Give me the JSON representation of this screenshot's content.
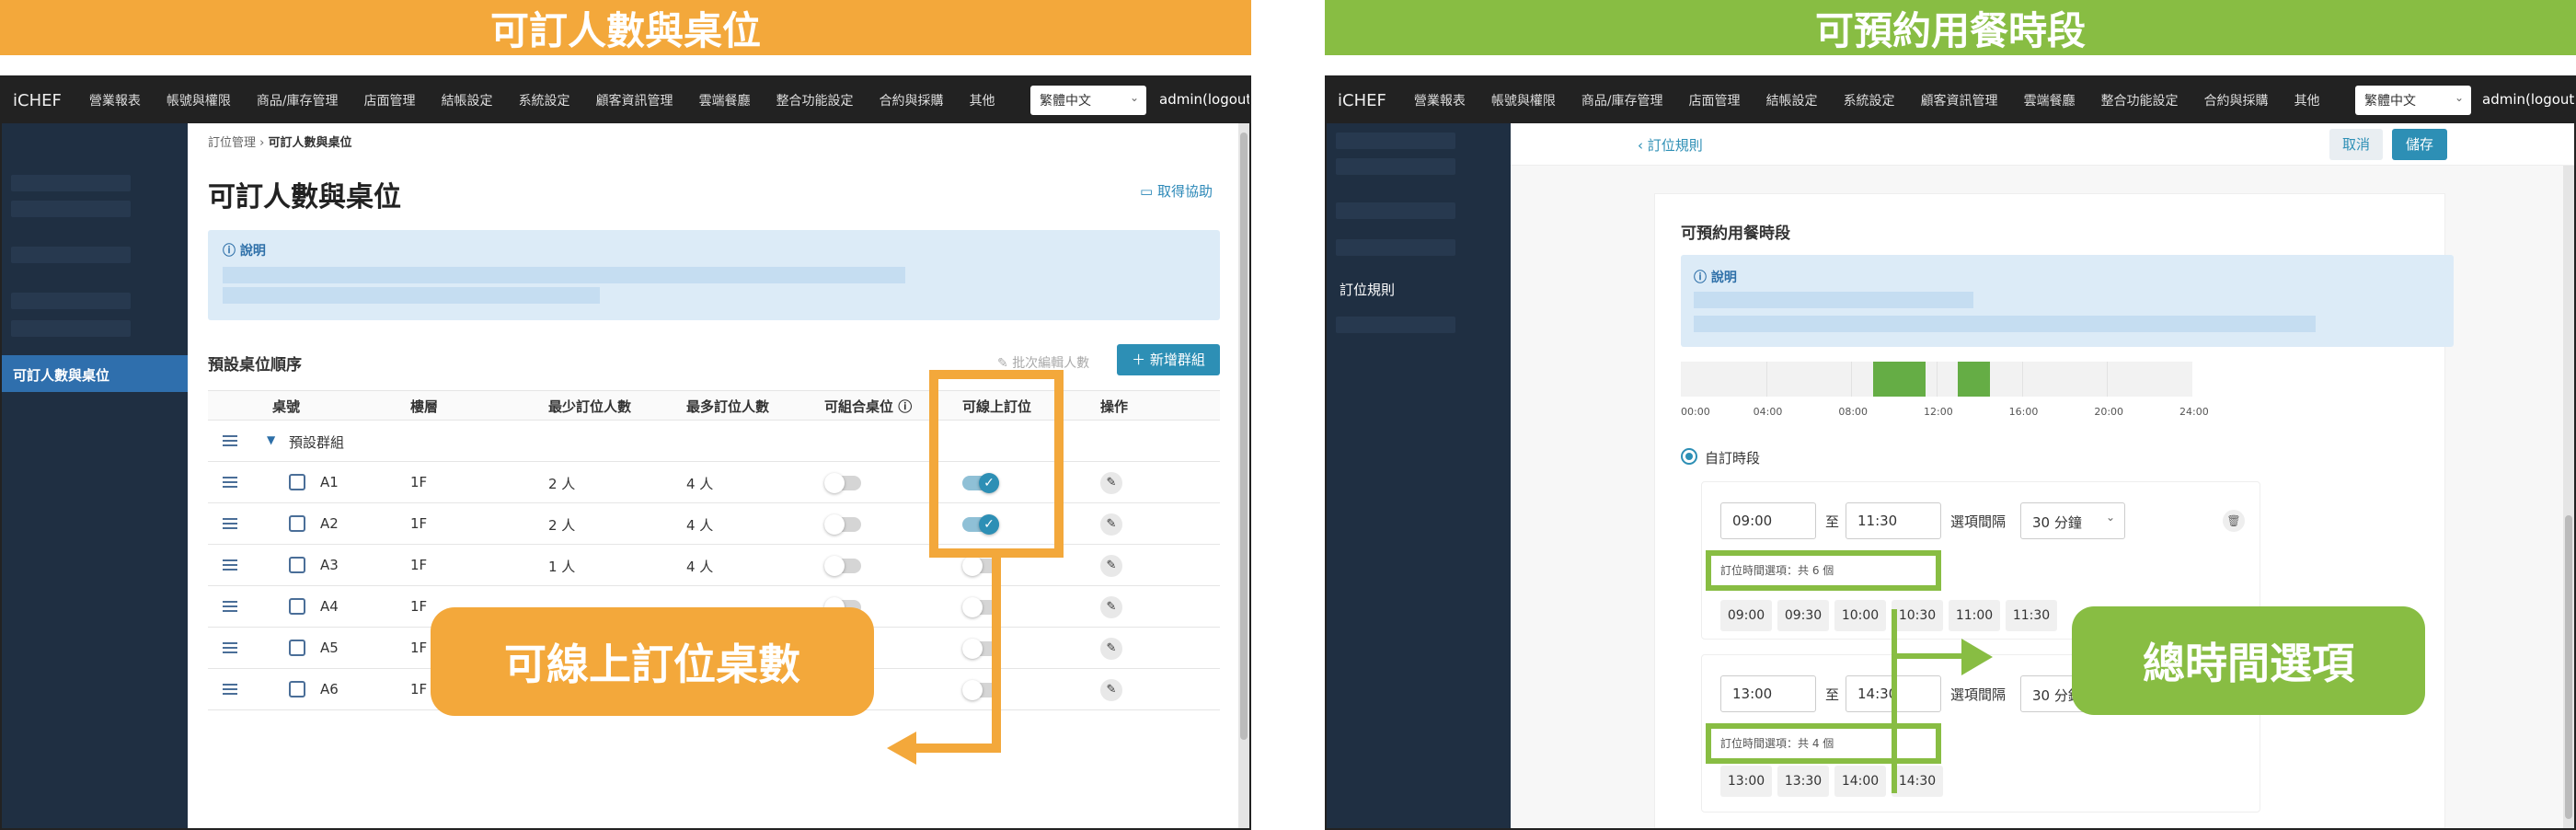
{
  "left": {
    "banner": "可訂人數與桌位",
    "nav": {
      "logo": "iCHEF",
      "items": [
        "營業報表",
        "帳號與權限",
        "商品/庫存管理",
        "店面管理",
        "結帳設定",
        "系統設定",
        "顧客資訊管理",
        "雲端餐廳",
        "整合功能設定",
        "合約與採購",
        "其他"
      ],
      "lang": "繁體中文",
      "admin": "admin(logout)"
    },
    "sidebar": {
      "active": "可訂人數與桌位"
    },
    "breadcrumb": {
      "parent": "訂位管理",
      "sep": "›",
      "current": "可訂人數與桌位"
    },
    "title": "可訂人數與桌位",
    "help": "取得協助",
    "note_header": "說明",
    "section_title": "預設桌位順序",
    "batch_edit": "批次編輯人數",
    "add_group": "＋ 新增群組",
    "table": {
      "headers": [
        "桌號",
        "樓層",
        "最少訂位人數",
        "最多訂位人數",
        "可組合桌位",
        "可線上訂位",
        "操作"
      ],
      "group": "預設群組",
      "rows": [
        {
          "name": "A1",
          "floor": "1F",
          "min": "2 人",
          "max": "4 人",
          "combine": false,
          "online": true
        },
        {
          "name": "A2",
          "floor": "1F",
          "min": "2 人",
          "max": "4 人",
          "combine": false,
          "online": true
        },
        {
          "name": "A3",
          "floor": "1F",
          "min": "1 人",
          "max": "4 人",
          "combine": false,
          "online": false
        },
        {
          "name": "A4",
          "floor": "1F",
          "min": "",
          "max": "",
          "combine": false,
          "online": false
        },
        {
          "name": "A5",
          "floor": "1F",
          "min": "",
          "max": "",
          "combine": false,
          "online": false
        },
        {
          "name": "A6",
          "floor": "1F",
          "min": "",
          "max": "",
          "combine": false,
          "online": false
        }
      ]
    },
    "callout": "可線上訂位桌數",
    "colors": {
      "accent": "#f3a83b",
      "primary": "#2d8fb5",
      "sidebar": "#1f2f42"
    }
  },
  "right": {
    "banner": "可預約用餐時段",
    "nav": {
      "logo": "iCHEF",
      "items": [
        "營業報表",
        "帳號與權限",
        "商品/庫存管理",
        "店面管理",
        "結帳設定",
        "系統設定",
        "顧客資訊管理",
        "雲端餐廳",
        "整合功能設定",
        "合約與採購",
        "其他"
      ],
      "lang": "繁體中文",
      "admin": "admin(logout)"
    },
    "sidebar": {
      "item": "訂位規則"
    },
    "back": "‹ 訂位規則",
    "cancel": "取消",
    "save": "儲存",
    "section_title": "可預約用餐時段",
    "note_header": "說明",
    "timeline": {
      "ticks": [
        "00:00",
        "04:00",
        "08:00",
        "12:00",
        "16:00",
        "20:00",
        "24:00"
      ],
      "ranges": [
        [
          9.0,
          11.5
        ],
        [
          13.0,
          14.5
        ]
      ]
    },
    "custom_label": "自訂時段",
    "slots": [
      {
        "start": "09:00",
        "to": "至",
        "end": "11:30",
        "interval_label": "選項間隔",
        "interval": "30 分鐘",
        "count_label": "訂位時間選項：共 6 個",
        "chips": [
          "09:00",
          "09:30",
          "10:00",
          "10:30",
          "11:00",
          "11:30"
        ]
      },
      {
        "start": "13:00",
        "to": "至",
        "end": "14:30",
        "interval_label": "選項間隔",
        "interval": "30 分鐘",
        "count_label": "訂位時間選項：共 4 個",
        "chips": [
          "13:00",
          "13:30",
          "14:00",
          "14:30"
        ]
      }
    ],
    "callout": "總時間選項",
    "colors": {
      "accent": "#88bd43",
      "bar": "#65ad45",
      "primary": "#2d8fb5"
    }
  }
}
